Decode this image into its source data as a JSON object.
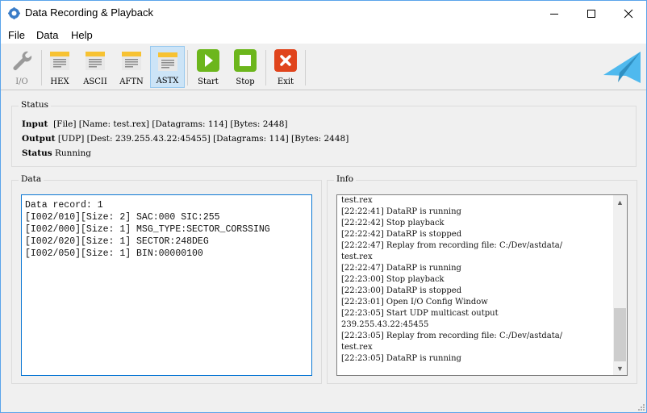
{
  "window": {
    "title": "Data Recording & Playback",
    "controls": {
      "minimize": "minimize-icon",
      "maximize": "maximize-icon",
      "close": "close-icon"
    }
  },
  "menu": [
    {
      "label": "File"
    },
    {
      "label": "Data"
    },
    {
      "label": "Help"
    }
  ],
  "toolbar": {
    "buttons": [
      {
        "id": "io",
        "label": "I/O",
        "icon": "wrench-icon",
        "enabled": false
      },
      {
        "id": "hex",
        "label": "HEX",
        "icon": "calendar-icon"
      },
      {
        "id": "ascii",
        "label": "ASCII",
        "icon": "calendar-icon"
      },
      {
        "id": "aftn",
        "label": "AFTN",
        "icon": "calendar-icon"
      },
      {
        "id": "astx",
        "label": "ASTX",
        "icon": "calendar-icon",
        "active": true
      },
      {
        "id": "start",
        "label": "Start",
        "icon": "play-icon"
      },
      {
        "id": "stop",
        "label": "Stop",
        "icon": "stop-icon"
      },
      {
        "id": "exit",
        "label": "Exit",
        "icon": "close-x-icon"
      }
    ],
    "logo": "paper-plane-icon"
  },
  "status": {
    "title": "Status",
    "input_label": "Input",
    "input_value": "[File] [Name: test.rex] [Datagrams: 114] [Bytes: 2448]",
    "output_label": "Output",
    "output_value": "[UDP] [Dest: 239.255.43.22:45455] [Datagrams: 114] [Bytes: 2448]",
    "status_label": "Status",
    "status_value": "Running"
  },
  "data_panel": {
    "title": "Data",
    "lines": [
      "Data record: 1",
      "[I002/010][Size: 2] SAC:000 SIC:255",
      "[I002/000][Size: 1] MSG_TYPE:SECTOR_CORSSING",
      "[I002/020][Size: 1] SECTOR:248DEG",
      "[I002/050][Size: 1] BIN:00000100"
    ]
  },
  "info_panel": {
    "title": "Info",
    "lines": [
      "test.rex",
      "[22:22:41] DataRP is running",
      "[22:22:42] Stop playback",
      "[22:22:42] DataRP is stopped",
      "[22:22:47] Replay from recording file: C:/Dev/astdata/",
      "test.rex",
      "[22:22:47] DataRP is running",
      "[22:23:00] Stop playback",
      "[22:23:00] DataRP is stopped",
      "[22:23:01] Open I/O Config Window",
      "[22:23:05] Start UDP multicast output",
      "239.255.43.22:45455",
      "[22:23:05] Replay from recording file: C:/Dev/astdata/",
      "test.rex",
      "[22:23:05] DataRP is running"
    ],
    "scroll_position": 0.75
  }
}
